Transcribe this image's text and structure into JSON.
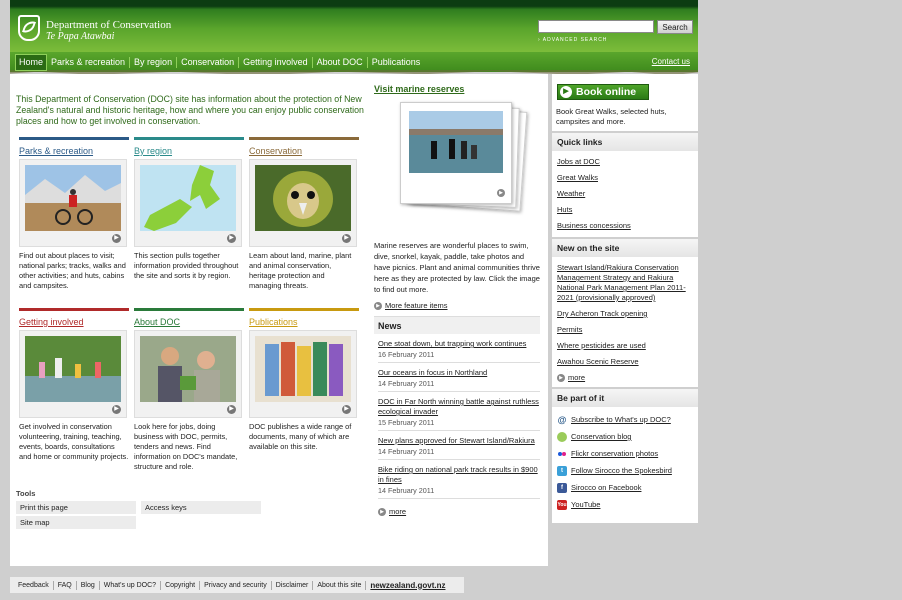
{
  "header": {
    "brand_name": "Department of Conservation",
    "brand_maori": "Te Papa Atawbai",
    "search_button": "Search",
    "search_value": "",
    "advanced_search": "› ADVANCED SEARCH",
    "contact": "Contact us"
  },
  "nav": [
    "Home",
    "Parks & recreation",
    "By region",
    "Conservation",
    "Getting involved",
    "About DOC",
    "Publications"
  ],
  "intro": "This Department of Conservation (DOC) site has information about the protection of New Zealand's natural and historic heritage, how and where you can enjoy public conservation places and how to get involved in conservation.",
  "tiles": [
    {
      "title": "Parks & recreation",
      "color": "#2b5a87",
      "desc": "Find out about places to visit; national parks; tracks, walks and other activities; and huts, cabins and campsites."
    },
    {
      "title": "By region",
      "color": "#2a8a8a",
      "desc": "This section pulls together information provided throughout the site and sorts it by region."
    },
    {
      "title": "Conservation",
      "color": "#8a6a3a",
      "desc": "Learn about land, marine, plant and animal conservation, heritage protection and managing threats."
    },
    {
      "title": "Getting involved",
      "color": "#b02a2a",
      "desc": "Get involved in conservation volunteering, training, teaching, events, boards, consultations and home or community projects."
    },
    {
      "title": "About DOC",
      "color": "#2a7a3a",
      "desc": "Look here for jobs, doing business with DOC, permits, tenders and news. Find information on DOC's mandate, structure and role."
    },
    {
      "title": "Publications",
      "color": "#c89a10",
      "desc": "DOC publishes a wide range of documents, many of which are available on this site."
    }
  ],
  "tools": {
    "heading": "Tools",
    "items": [
      "Print this page",
      "Access keys",
      "Site map"
    ]
  },
  "feature": {
    "link": "Visit marine reserves",
    "desc": "Marine reserves are wonderful places to swim, dive, snorkel, kayak, paddle, take photos and have picnics. Plant and animal communities thrive here as they are protected by law. Click the image to find out more.",
    "more": "More feature items"
  },
  "news": {
    "heading": "News",
    "items": [
      {
        "title": "One stoat down, but trapping work continues",
        "date": "16 February 2011"
      },
      {
        "title": "Our oceans in focus in Northland",
        "date": "14 February 2011"
      },
      {
        "title": "DOC in Far North winning battle against ruthless ecological invader",
        "date": "15 February 2011"
      },
      {
        "title": "New plans approved for Stewart Island/Rakiura",
        "date": "14 February 2011"
      },
      {
        "title": "Bike riding on national park track results in $900 in fines",
        "date": "14 February 2011"
      }
    ],
    "more": "more"
  },
  "book": {
    "label": "Book online",
    "desc": "Book Great Walks, selected huts, campsites and more."
  },
  "quick_links": {
    "heading": "Quick links",
    "items": [
      "Jobs at DOC",
      "Great Walks",
      "Weather",
      "Huts",
      "Business concessions"
    ]
  },
  "new_on_site": {
    "heading": "New on the site",
    "items": [
      "Stewart Island/Rakiura Conservation Management Strategy and Rakiura National Park Management Plan 2011-2021 (provisionally approved)",
      "Dry Acheron Track opening",
      "Permits",
      "Where pesticides are used",
      "Awahou Scenic Reserve"
    ],
    "more": "more"
  },
  "be_part": {
    "heading": "Be part of it",
    "items": [
      {
        "label": "Subscribe to What's up DOC?",
        "icon": "at-icon"
      },
      {
        "label": "Conservation blog",
        "icon": "chat-icon"
      },
      {
        "label": "Flickr conservation photos",
        "icon": "flickr-icon"
      },
      {
        "label": "Follow Sirocco the Spokesbird",
        "icon": "twitter-icon"
      },
      {
        "label": "Sirocco on Facebook",
        "icon": "facebook-icon"
      },
      {
        "label": "YouTube",
        "icon": "youtube-icon"
      }
    ]
  },
  "footer": {
    "items": [
      "Feedback",
      "FAQ",
      "Blog",
      "What's up DOC?",
      "Copyright",
      "Privacy and security",
      "Disclaimer",
      "About this site"
    ],
    "govt": "newzealand.govt.nz"
  }
}
